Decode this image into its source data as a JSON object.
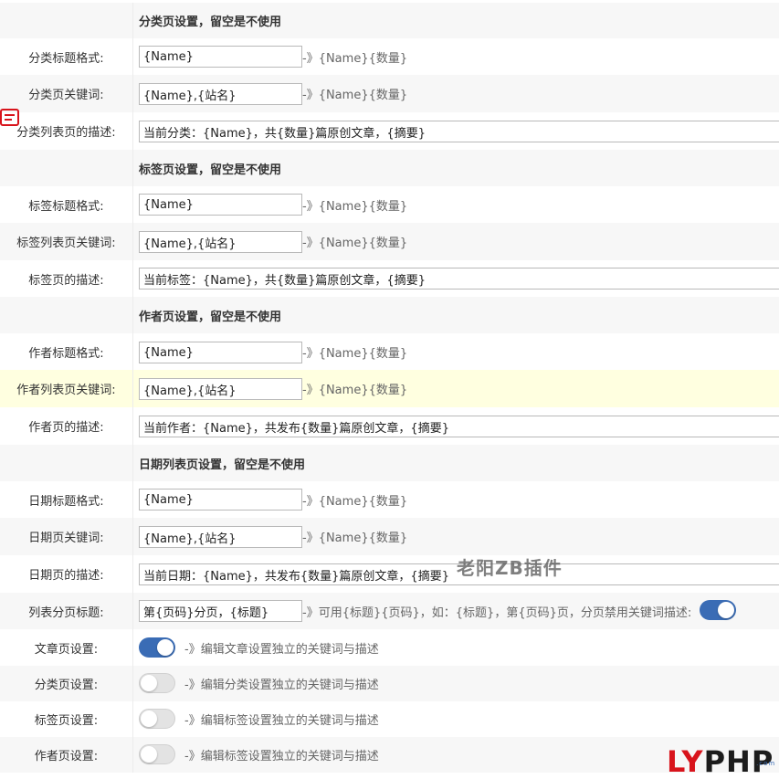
{
  "sections": {
    "category": "分类页设置，留空是不使用",
    "tag": "标签页设置，留空是不使用",
    "author": "作者页设置，留空是不使用",
    "date": "日期列表页设置，留空是不使用"
  },
  "fields": {
    "cat_title": {
      "label": "分类标题格式:",
      "value": "{Name}",
      "hint": "-》{Name}{数量}"
    },
    "cat_keywords": {
      "label": "分类页关键词:",
      "value": "{Name},{站名}",
      "hint": "-》{Name}{数量}"
    },
    "cat_desc": {
      "label": "分类列表页的描述:",
      "value": "当前分类：{Name}，共{数量}篇原创文章，{摘要}"
    },
    "tag_title": {
      "label": "标签标题格式:",
      "value": "{Name}",
      "hint": "-》{Name}{数量}"
    },
    "tag_keywords": {
      "label": "标签列表页关键词:",
      "value": "{Name},{站名}",
      "hint": "-》{Name}{数量}"
    },
    "tag_desc": {
      "label": "标签页的描述:",
      "value": "当前标签：{Name}，共{数量}篇原创文章，{摘要}"
    },
    "author_title": {
      "label": "作者标题格式:",
      "value": "{Name}",
      "hint": "-》{Name}{数量}"
    },
    "author_keywords": {
      "label": "作者列表页关键词:",
      "value": "{Name},{站名}",
      "hint": "-》{Name}{数量}"
    },
    "author_desc": {
      "label": "作者页的描述:",
      "value": "当前作者：{Name}，共发布{数量}篇原创文章，{摘要}"
    },
    "date_title": {
      "label": "日期标题格式:",
      "value": "{Name}",
      "hint": "-》{Name}{数量}"
    },
    "date_keywords": {
      "label": "日期页关键词:",
      "value": "{Name},{站名}",
      "hint": "-》{Name}{数量}"
    },
    "date_desc": {
      "label": "日期页的描述:",
      "value": "当前日期：{Name}，共发布{数量}篇原创文章，{摘要}"
    },
    "pagination_title": {
      "label": "列表分页标题:",
      "value": "第{页码}分页，{标题}",
      "hint": "-》可用{标题}{页码}，如：{标题}，第{页码}页，分页禁用关键词描述:",
      "toggle_on": true
    }
  },
  "toggles": {
    "article": {
      "label": "文章页设置:",
      "hint": "-》编辑文章设置独立的关键词与描述",
      "on": true
    },
    "category": {
      "label": "分类页设置:",
      "hint": "-》编辑分类设置独立的关键词与描述",
      "on": false
    },
    "tag": {
      "label": "标签页设置:",
      "hint": "-》编辑标签设置独立的关键词与描述",
      "on": false
    },
    "author": {
      "label": "作者页设置:",
      "hint": "-》编辑标签设置独立的关键词与描述",
      "on": false
    }
  },
  "watermark": {
    "text": "老阳ZB插件"
  },
  "logo": {
    "ly": "LY",
    "php": "PHP",
    "suffix": ".com"
  },
  "colors": {
    "accent": "#3a6cb5",
    "highlight_row": "#ffffe0",
    "logo_red": "#d8141c"
  }
}
